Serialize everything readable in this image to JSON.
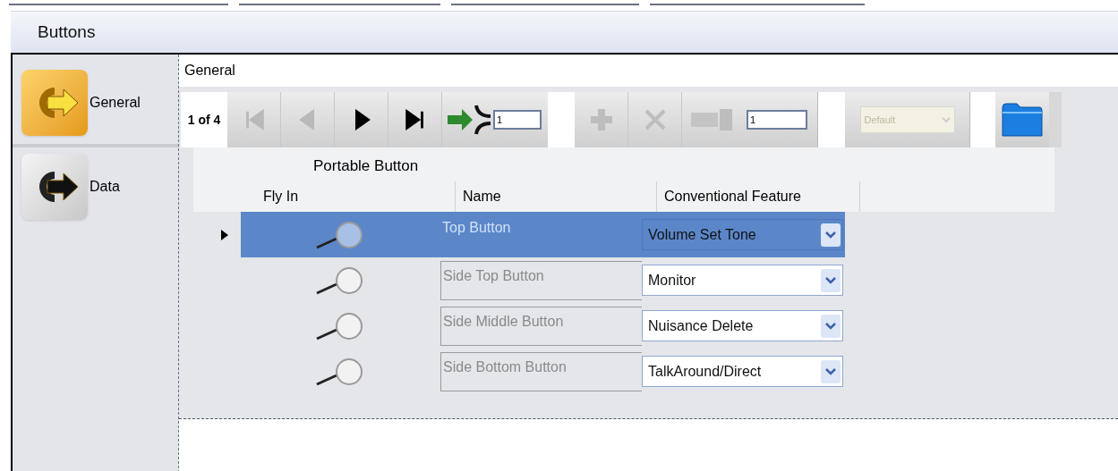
{
  "window": {
    "title": "Buttons"
  },
  "sidebar": {
    "items": [
      {
        "label": "General",
        "selected": true
      },
      {
        "label": "Data",
        "selected": false
      }
    ]
  },
  "panel": {
    "title": "General"
  },
  "navigator": {
    "position": "1 of 4",
    "buttons": [
      {
        "kind": "first",
        "disabled": true
      },
      {
        "kind": "prev",
        "disabled": true
      },
      {
        "kind": "next",
        "disabled": false
      },
      {
        "kind": "last",
        "disabled": false
      }
    ],
    "goto_value": "1",
    "edit_buttons": [
      {
        "kind": "add",
        "disabled": true
      },
      {
        "kind": "delete",
        "disabled": true
      }
    ],
    "count_value": "1",
    "dropdown": {
      "value": "Default",
      "disabled": true
    }
  },
  "grid": {
    "group_header": "Portable Button",
    "columns": [
      "Fly In",
      "Name",
      "Conventional Feature"
    ],
    "rows": [
      {
        "name": "Top Button",
        "feature": "Volume Set Tone",
        "selected": true
      },
      {
        "name": "Side Top Button",
        "feature": "Monitor",
        "selected": false
      },
      {
        "name": "Side Middle Button",
        "feature": "Nuisance Delete",
        "selected": false
      },
      {
        "name": "Side Bottom Button",
        "feature": "TalkAround/Direct",
        "selected": false
      }
    ]
  }
}
